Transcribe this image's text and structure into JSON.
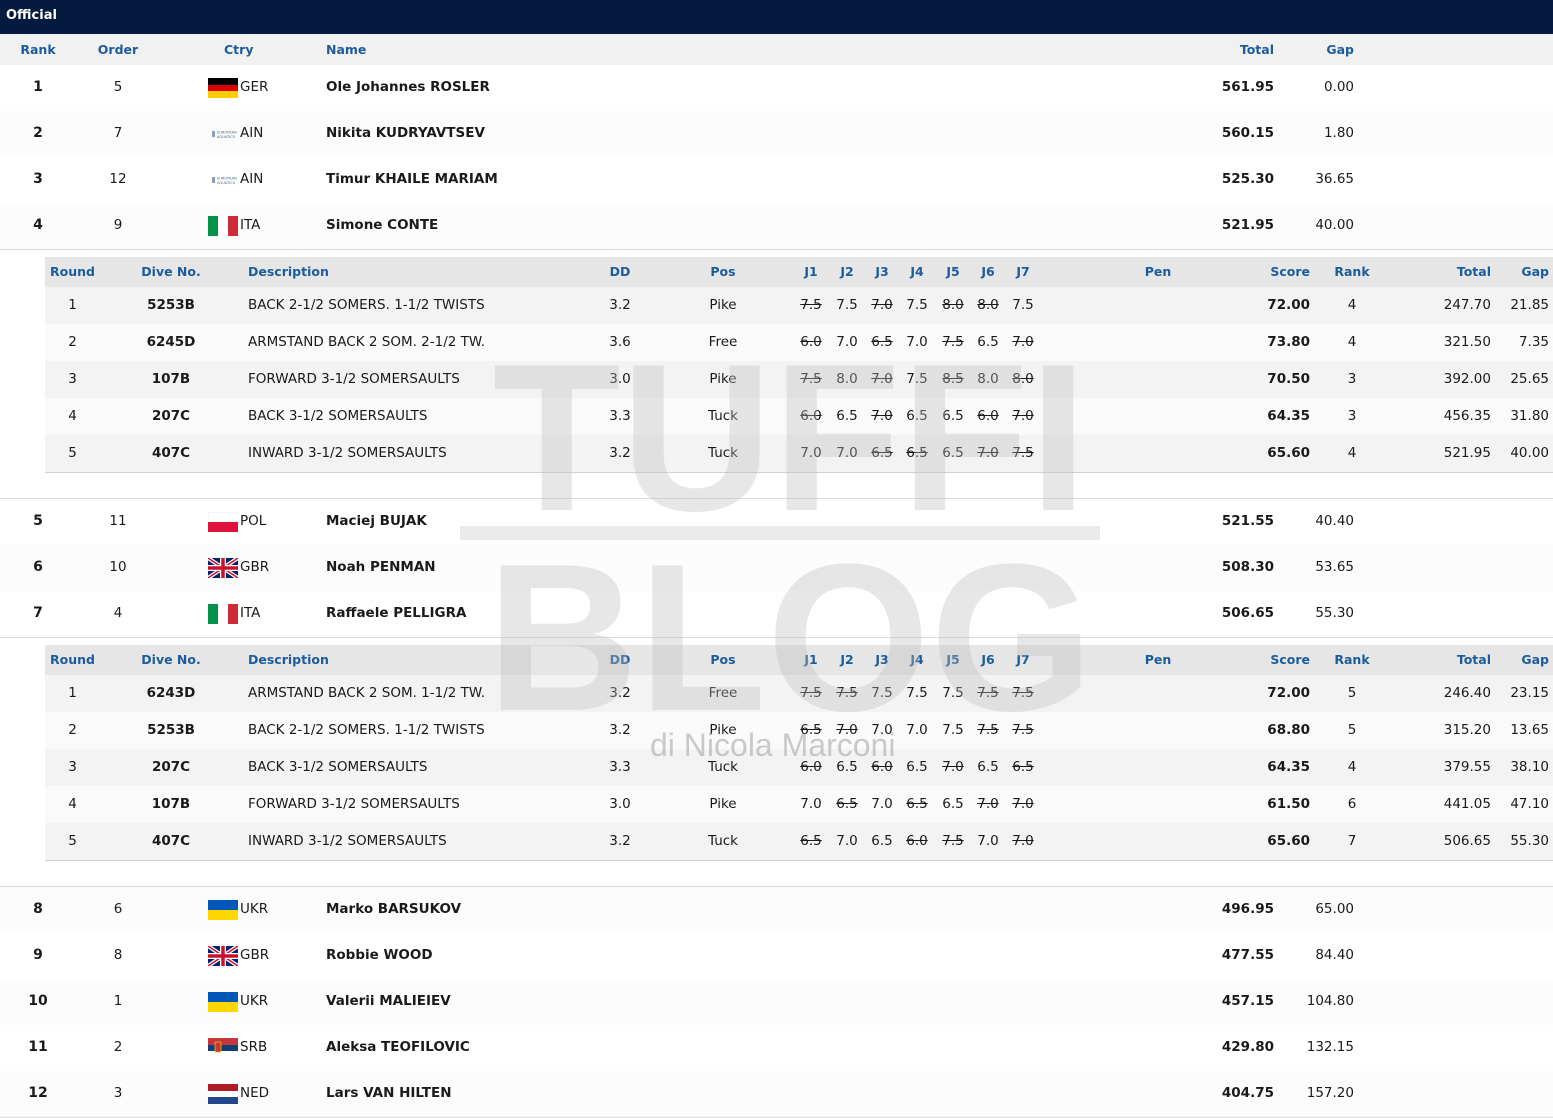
{
  "header": {
    "title": "Official"
  },
  "columns": {
    "rank": "Rank",
    "order": "Order",
    "ctry": "Ctry",
    "name": "Name",
    "total": "Total",
    "gap": "Gap"
  },
  "detail_columns": {
    "round": "Round",
    "dive": "Dive No.",
    "desc": "Description",
    "dd": "DD",
    "pos": "Pos",
    "j1": "J1",
    "j2": "J2",
    "j3": "J3",
    "j4": "J4",
    "j5": "J5",
    "j6": "J6",
    "j7": "J7",
    "pen": "Pen",
    "score": "Score",
    "rank": "Rank",
    "total": "Total",
    "gap": "Gap"
  },
  "athletes": [
    {
      "rank": "1",
      "order": "5",
      "flag": "ger",
      "ctry": "GER",
      "name": "Ole Johannes ROSLER",
      "total": "561.95",
      "gap": "0.00"
    },
    {
      "rank": "2",
      "order": "7",
      "flag": "ain",
      "ctry": "AIN",
      "name": "Nikita KUDRYAVTSEV",
      "total": "560.15",
      "gap": "1.80"
    },
    {
      "rank": "3",
      "order": "12",
      "flag": "ain",
      "ctry": "AIN",
      "name": "Timur KHAILE MARIAM",
      "total": "525.30",
      "gap": "36.65"
    },
    {
      "rank": "4",
      "order": "9",
      "flag": "ita",
      "ctry": "ITA",
      "name": "Simone CONTE",
      "total": "521.95",
      "gap": "40.00",
      "dives": [
        {
          "round": "1",
          "dive": "5253B",
          "desc": "BACK 2-1/2 SOMERS. 1-1/2 TWISTS",
          "dd": "3.2",
          "pos": "Pike",
          "j": [
            "7.5",
            "7.5",
            "7.0",
            "7.5",
            "8.0",
            "8.0",
            "7.5"
          ],
          "x": [
            0,
            2,
            4,
            5
          ],
          "pen": "",
          "score": "72.00",
          "rank": "4",
          "total": "247.70",
          "gap": "21.85"
        },
        {
          "round": "2",
          "dive": "6245D",
          "desc": "ARMSTAND BACK 2 SOM. 2-1/2 TW.",
          "dd": "3.6",
          "pos": "Free",
          "j": [
            "6.0",
            "7.0",
            "6.5",
            "7.0",
            "7.5",
            "6.5",
            "7.0"
          ],
          "x": [
            0,
            2,
            4,
            6
          ],
          "pen": "",
          "score": "73.80",
          "rank": "4",
          "total": "321.50",
          "gap": "7.35"
        },
        {
          "round": "3",
          "dive": "107B",
          "desc": "FORWARD 3-1/2 SOMERSAULTS",
          "dd": "3.0",
          "pos": "Pike",
          "j": [
            "7.5",
            "8.0",
            "7.0",
            "7.5",
            "8.5",
            "8.0",
            "8.0"
          ],
          "x": [
            0,
            2,
            4,
            6
          ],
          "pen": "",
          "score": "70.50",
          "rank": "3",
          "total": "392.00",
          "gap": "25.65"
        },
        {
          "round": "4",
          "dive": "207C",
          "desc": "BACK 3-1/2 SOMERSAULTS",
          "dd": "3.3",
          "pos": "Tuck",
          "j": [
            "6.0",
            "6.5",
            "7.0",
            "6.5",
            "6.5",
            "6.0",
            "7.0"
          ],
          "x": [
            0,
            2,
            5,
            6
          ],
          "pen": "",
          "score": "64.35",
          "rank": "3",
          "total": "456.35",
          "gap": "31.80"
        },
        {
          "round": "5",
          "dive": "407C",
          "desc": "INWARD 3-1/2 SOMERSAULTS",
          "dd": "3.2",
          "pos": "Tuck",
          "j": [
            "7.0",
            "7.0",
            "6.5",
            "6.5",
            "6.5",
            "7.0",
            "7.5"
          ],
          "x": [
            2,
            3,
            5,
            6
          ],
          "pen": "",
          "score": "65.60",
          "rank": "4",
          "total": "521.95",
          "gap": "40.00"
        }
      ]
    },
    {
      "rank": "5",
      "order": "11",
      "flag": "pol",
      "ctry": "POL",
      "name": "Maciej BUJAK",
      "total": "521.55",
      "gap": "40.40"
    },
    {
      "rank": "6",
      "order": "10",
      "flag": "gbr",
      "ctry": "GBR",
      "name": "Noah PENMAN",
      "total": "508.30",
      "gap": "53.65"
    },
    {
      "rank": "7",
      "order": "4",
      "flag": "ita",
      "ctry": "ITA",
      "name": "Raffaele PELLIGRA",
      "total": "506.65",
      "gap": "55.30",
      "dives": [
        {
          "round": "1",
          "dive": "6243D",
          "desc": "ARMSTAND BACK 2 SOM. 1-1/2 TW.",
          "dd": "3.2",
          "pos": "Free",
          "j": [
            "7.5",
            "7.5",
            "7.5",
            "7.5",
            "7.5",
            "7.5",
            "7.5"
          ],
          "x": [
            0,
            1,
            5,
            6
          ],
          "pen": "",
          "score": "72.00",
          "rank": "5",
          "total": "246.40",
          "gap": "23.15"
        },
        {
          "round": "2",
          "dive": "5253B",
          "desc": "BACK 2-1/2 SOMERS. 1-1/2 TWISTS",
          "dd": "3.2",
          "pos": "Pike",
          "j": [
            "6.5",
            "7.0",
            "7.0",
            "7.0",
            "7.5",
            "7.5",
            "7.5"
          ],
          "x": [
            0,
            1,
            5,
            6
          ],
          "pen": "",
          "score": "68.80",
          "rank": "5",
          "total": "315.20",
          "gap": "13.65"
        },
        {
          "round": "3",
          "dive": "207C",
          "desc": "BACK 3-1/2 SOMERSAULTS",
          "dd": "3.3",
          "pos": "Tuck",
          "j": [
            "6.0",
            "6.5",
            "6.0",
            "6.5",
            "7.0",
            "6.5",
            "6.5"
          ],
          "x": [
            0,
            2,
            4,
            6
          ],
          "pen": "",
          "score": "64.35",
          "rank": "4",
          "total": "379.55",
          "gap": "38.10"
        },
        {
          "round": "4",
          "dive": "107B",
          "desc": "FORWARD 3-1/2 SOMERSAULTS",
          "dd": "3.0",
          "pos": "Pike",
          "j": [
            "7.0",
            "6.5",
            "7.0",
            "6.5",
            "6.5",
            "7.0",
            "7.0"
          ],
          "x": [
            1,
            3,
            5,
            6
          ],
          "pen": "",
          "score": "61.50",
          "rank": "6",
          "total": "441.05",
          "gap": "47.10"
        },
        {
          "round": "5",
          "dive": "407C",
          "desc": "INWARD 3-1/2 SOMERSAULTS",
          "dd": "3.2",
          "pos": "Tuck",
          "j": [
            "6.5",
            "7.0",
            "6.5",
            "6.0",
            "7.5",
            "7.0",
            "7.0"
          ],
          "x": [
            0,
            3,
            4,
            6
          ],
          "pen": "",
          "score": "65.60",
          "rank": "7",
          "total": "506.65",
          "gap": "55.30"
        }
      ]
    },
    {
      "rank": "8",
      "order": "6",
      "flag": "ukr",
      "ctry": "UKR",
      "name": "Marko BARSUKOV",
      "total": "496.95",
      "gap": "65.00"
    },
    {
      "rank": "9",
      "order": "8",
      "flag": "gbr",
      "ctry": "GBR",
      "name": "Robbie WOOD",
      "total": "477.55",
      "gap": "84.40"
    },
    {
      "rank": "10",
      "order": "1",
      "flag": "ukr",
      "ctry": "UKR",
      "name": "Valerii MALIEIEV",
      "total": "457.15",
      "gap": "104.80"
    },
    {
      "rank": "11",
      "order": "2",
      "flag": "srb",
      "ctry": "SRB",
      "name": "Aleksa TEOFILOVIC",
      "total": "429.80",
      "gap": "132.15"
    },
    {
      "rank": "12",
      "order": "3",
      "flag": "ned",
      "ctry": "NED",
      "name": "Lars VAN HILTEN",
      "total": "404.75",
      "gap": "157.20"
    }
  ],
  "ain_logo": {
    "line1": "EUROPEAN",
    "line2": "AQUATICS"
  },
  "watermark": {
    "line1": "TUFFI",
    "line2": "BLOG",
    "sub": "di Nicola Marconi"
  }
}
